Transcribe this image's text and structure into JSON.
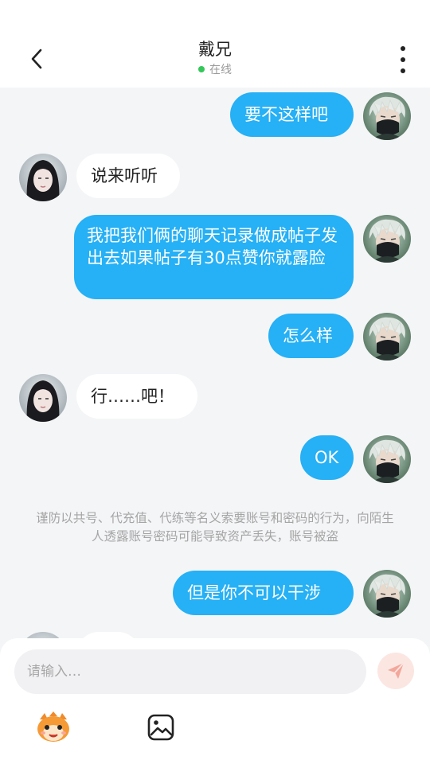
{
  "header": {
    "title": "戴兄",
    "status": "在线"
  },
  "messages": [
    {
      "side": "me",
      "text": "要不这样吧"
    },
    {
      "side": "other",
      "text": "说来听听"
    },
    {
      "side": "me",
      "text": "我把我们俩的聊天记录做成帖子发出去如果帖子有30点赞你就露脸"
    },
    {
      "side": "me",
      "text": "怎么样"
    },
    {
      "side": "other",
      "text": "行……吧！"
    },
    {
      "side": "me",
      "text": "OK"
    },
    {
      "side": "me",
      "text": "但是你不可以干涉"
    }
  ],
  "notice": "谨防以共号、代充值、代练等名义索要账号和密码的行为，向陌生人透露账号密码可能导致资产丢失，账号被盗",
  "composer": {
    "placeholder": "请输入…"
  },
  "icons": {
    "back": "chevron-left-icon",
    "more": "more-vertical-icon",
    "send": "send-icon",
    "emoji": "emoji-mascot-icon",
    "image": "image-icon"
  },
  "colors": {
    "my_bubble": "#26b0f5",
    "other_bubble": "#ffffff",
    "online_dot": "#34c759",
    "send_bg": "#fbe6e2",
    "send_icon": "#f3a79a"
  }
}
